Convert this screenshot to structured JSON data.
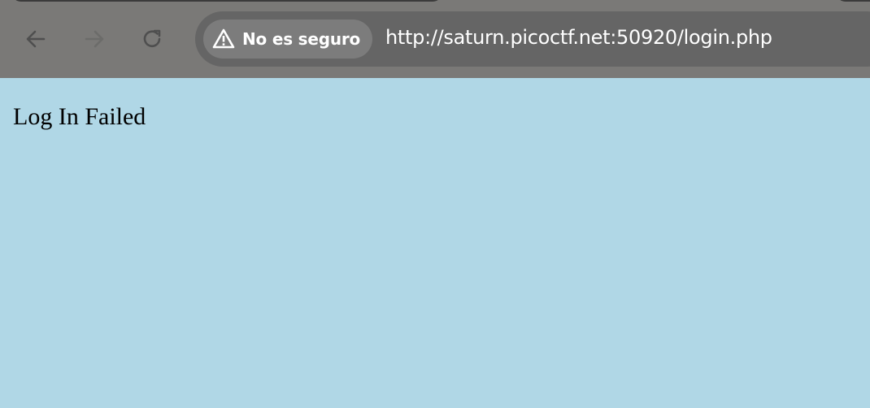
{
  "browser": {
    "security_label": "No es seguro",
    "url": "http://saturn.picoctf.net:50920/login.php",
    "icons": {
      "back": "arrow-left-icon",
      "forward": "arrow-right-icon",
      "reload": "reload-icon",
      "security": "warning-triangle-icon"
    },
    "colors": {
      "toolbar": "#7a7977",
      "omnibox": "#656565",
      "security_chip": "#7c7c7c"
    }
  },
  "page": {
    "message": "Log In Failed",
    "background_color": "#b0d7e6"
  }
}
